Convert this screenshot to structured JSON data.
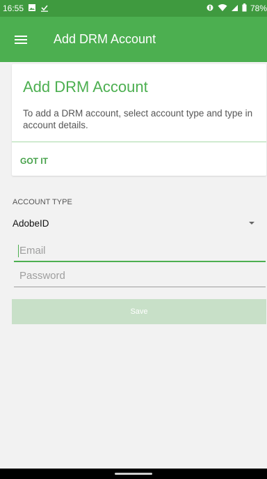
{
  "status_bar": {
    "time": "16:55",
    "battery": "78%",
    "icons": [
      "image-icon",
      "download-check-icon",
      "data-saver-icon",
      "wifi-icon",
      "signal-icon",
      "battery-icon"
    ]
  },
  "app_bar": {
    "title": "Add DRM Account",
    "menu_icon": "hamburger-menu-icon"
  },
  "info_card": {
    "title": "Add DRM Account",
    "text": "To add a DRM account, select account type and type in account details.",
    "action": "GOT IT"
  },
  "form": {
    "account_type_label": "ACCOUNT TYPE",
    "account_type_value": "AdobeID",
    "email_placeholder": "Email",
    "password_placeholder": "Password",
    "save_label": "Save"
  },
  "colors": {
    "primary": "#4caf50",
    "status_bar": "#3f9a3f",
    "disabled_button": "#c8e0c8"
  }
}
